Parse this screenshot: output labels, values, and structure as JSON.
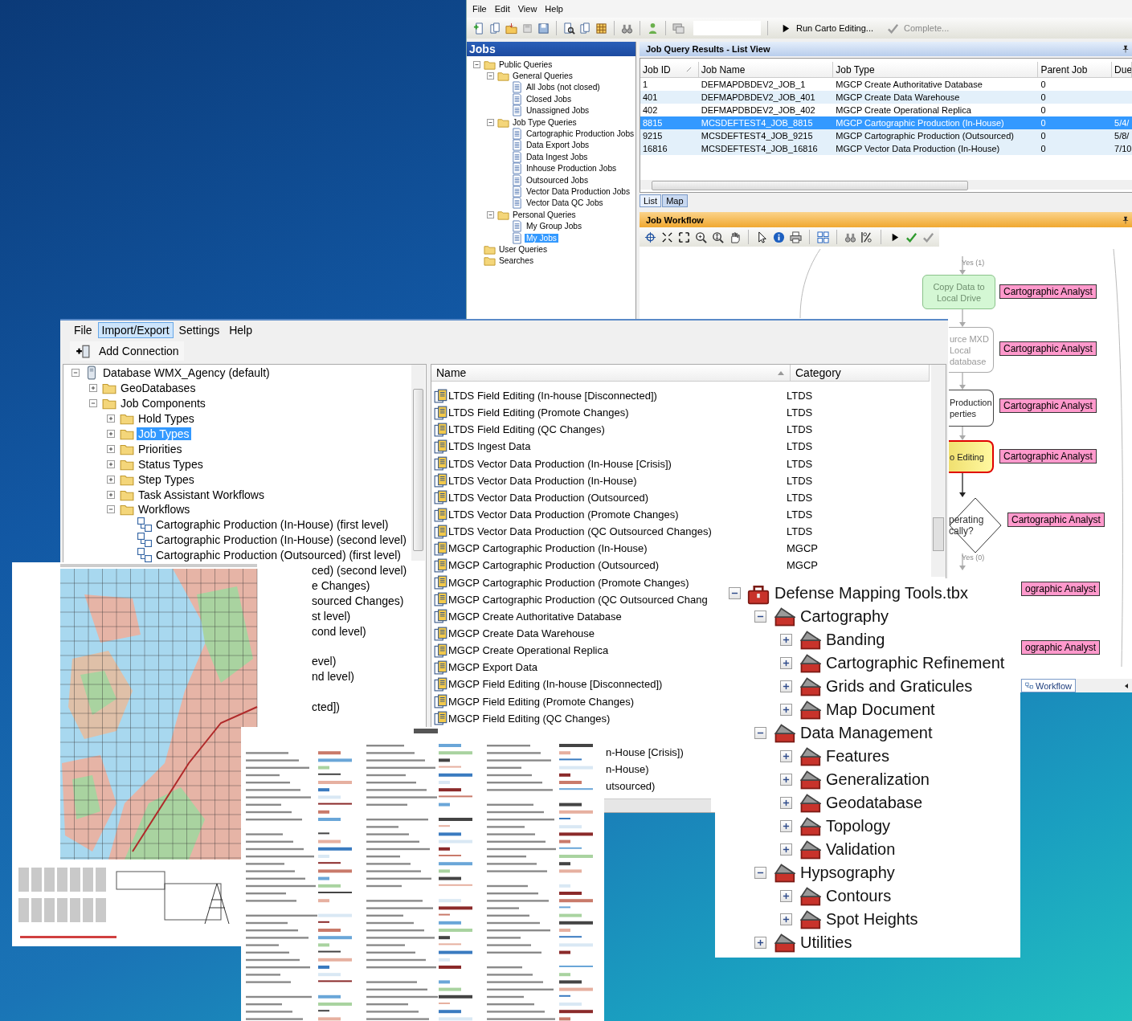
{
  "job_manager": {
    "menu": [
      "File",
      "Edit",
      "View",
      "Help"
    ],
    "toolbar": {
      "run_button": "Run Carto Editing...",
      "complete_button": {
        "label": "Complete...",
        "disabled": true
      }
    },
    "jobs_panel": {
      "title": "Jobs",
      "tree": [
        {
          "kind": "folder",
          "label": "Public Queries",
          "expanded": true,
          "selected": false,
          "children": [
            {
              "kind": "folder",
              "label": "General Queries",
              "expanded": true,
              "selected": false,
              "children": [
                {
                  "kind": "query",
                  "label": "All Jobs (not closed)",
                  "selected": false
                },
                {
                  "kind": "query",
                  "label": "Closed Jobs",
                  "selected": false
                },
                {
                  "kind": "query",
                  "label": "Unassigned Jobs",
                  "selected": false
                }
              ]
            },
            {
              "kind": "folder",
              "label": "Job Type Queries",
              "expanded": true,
              "selected": false,
              "children": [
                {
                  "kind": "query",
                  "label": "Cartographic Production Jobs",
                  "selected": false
                },
                {
                  "kind": "query",
                  "label": "Data Export Jobs",
                  "selected": false
                },
                {
                  "kind": "query",
                  "label": "Data Ingest Jobs",
                  "selected": false
                },
                {
                  "kind": "query",
                  "label": "Inhouse Production Jobs",
                  "selected": false
                },
                {
                  "kind": "query",
                  "label": "Outsourced Jobs",
                  "selected": false
                },
                {
                  "kind": "query",
                  "label": "Vector Data Production Jobs",
                  "selected": false
                },
                {
                  "kind": "query",
                  "label": "Vector Data QC Jobs",
                  "selected": false
                }
              ]
            },
            {
              "kind": "folder",
              "label": "Personal Queries",
              "expanded": true,
              "selected": false,
              "children": [
                {
                  "kind": "query",
                  "label": "My Group Jobs",
                  "selected": false
                },
                {
                  "kind": "query",
                  "label": "My Jobs",
                  "selected": true
                }
              ]
            }
          ]
        },
        {
          "kind": "folder",
          "label": "User Queries",
          "selected": false
        },
        {
          "kind": "folder",
          "label": "Searches",
          "selected": false
        }
      ]
    },
    "query_results": {
      "title": "Job Query Results - List View",
      "columns": [
        {
          "label": "Job ID",
          "sorted": true
        },
        {
          "label": "Job Name",
          "sorted": false
        },
        {
          "label": "Job Type",
          "sorted": false
        },
        {
          "label": "Parent Job",
          "sorted": false
        },
        {
          "label": "Due",
          "sorted": false
        }
      ],
      "rows": [
        {
          "cells": [
            "1",
            "DEFMAPDBDEV2_JOB_1",
            "MGCP Create Authoritative Database",
            "0"
          ],
          "selected": false
        },
        {
          "cells": [
            "401",
            "DEFMAPDBDEV2_JOB_401",
            "MGCP Create Data Warehouse",
            "0"
          ],
          "selected": false
        },
        {
          "cells": [
            "402",
            "DEFMAPDBDEV2_JOB_402",
            "MGCP Create Operational Replica",
            "0"
          ],
          "selected": false
        },
        {
          "cells": [
            "8815",
            "MCSDEFTEST4_JOB_8815",
            "MGCP Cartographic Production (In-House)",
            "0",
            "5/4/"
          ],
          "selected": true
        },
        {
          "cells": [
            "9215",
            "MCSDEFTEST4_JOB_9215",
            "MGCP Cartographic Production (Outsourced)",
            "0",
            "5/8/"
          ],
          "selected": false
        },
        {
          "cells": [
            "16816",
            "MCSDEFTEST4_JOB_16816",
            "MGCP Vector Data Production (In-House)",
            "0",
            "7/10"
          ],
          "selected": false
        }
      ],
      "view_tabs": [
        {
          "label": "List",
          "selected": true
        },
        {
          "label": "Map",
          "selected": false
        }
      ]
    },
    "workflow": {
      "title": "Job Workflow",
      "items": [
        {
          "kind": "edge_label",
          "text": "Yes (1)"
        },
        {
          "kind": "step",
          "lines": [
            "Copy Data to",
            "Local Drive"
          ],
          "completed": true,
          "current": false,
          "dimmed": false,
          "role": "Cartographic Analyst"
        },
        {
          "kind": "step",
          "lines": [
            "urce MXD",
            "Local",
            "database"
          ],
          "completed": false,
          "current": false,
          "dimmed": true,
          "role": "Cartographic Analyst"
        },
        {
          "kind": "step",
          "lines": [
            "Production",
            "perties"
          ],
          "completed": false,
          "current": false,
          "dimmed": false,
          "role": "Cartographic Analyst"
        },
        {
          "kind": "step",
          "lines": [
            "o Editing"
          ],
          "completed": false,
          "current": true,
          "dimmed": false,
          "role": "Cartographic Analyst"
        },
        {
          "kind": "decision",
          "lines": [
            "perating",
            "cally?"
          ],
          "role": "Cartographic Analyst"
        },
        {
          "kind": "edge_label",
          "text": "Yes (0)"
        },
        {
          "kind": "role_only",
          "role": "ographic Analyst"
        },
        {
          "kind": "role_only",
          "role": "ographic Analyst"
        }
      ],
      "tabs": [
        {
          "label": "Workflow",
          "selected": true
        }
      ]
    }
  },
  "workflow_manager": {
    "menu": [
      {
        "label": "File",
        "selected": false
      },
      {
        "label": "Import/Export",
        "selected": true
      },
      {
        "label": "Settings",
        "selected": false
      },
      {
        "label": "Help",
        "selected": false
      }
    ],
    "add_connection": "Add Connection",
    "tree": [
      {
        "kind": "database",
        "label": "Database WMX_Agency (default)",
        "expanded": true,
        "selected": false,
        "children": [
          {
            "kind": "folder",
            "label": "GeoDatabases",
            "expanded": false,
            "selected": false
          },
          {
            "kind": "folder",
            "label": "Job Components",
            "expanded": true,
            "selected": false,
            "children": [
              {
                "kind": "folder",
                "label": "Hold Types",
                "expanded": false,
                "selected": false
              },
              {
                "kind": "folder",
                "label": "Job Types",
                "expanded": false,
                "selected": true
              },
              {
                "kind": "folder",
                "label": "Priorities",
                "expanded": false,
                "selected": false
              },
              {
                "kind": "folder",
                "label": "Status Types",
                "expanded": false,
                "selected": false
              },
              {
                "kind": "folder",
                "label": "Step Types",
                "expanded": false,
                "selected": false
              },
              {
                "kind": "folder",
                "label": "Task Assistant Workflows",
                "expanded": false,
                "selected": false
              },
              {
                "kind": "folder",
                "label": "Workflows",
                "expanded": true,
                "selected": false,
                "children": [
                  {
                    "kind": "workflow",
                    "label": "Cartographic Production (In-House) (first level)",
                    "selected": false
                  },
                  {
                    "kind": "workflow",
                    "label": "Cartographic Production (In-House) (second level)",
                    "selected": false
                  },
                  {
                    "kind": "workflow",
                    "label": "Cartographic Production (Outsourced) (first level)",
                    "selected": false
                  },
                  {
                    "kind": "clipped",
                    "label": "ced) (second level)",
                    "selected": false
                  },
                  {
                    "kind": "clipped",
                    "label": "e Changes)",
                    "selected": false
                  },
                  {
                    "kind": "clipped",
                    "label": "sourced Changes)",
                    "selected": false
                  },
                  {
                    "kind": "clipped",
                    "label": "st level)",
                    "selected": false
                  },
                  {
                    "kind": "clipped",
                    "label": "cond level)",
                    "selected": false
                  },
                  {
                    "kind": "covered"
                  },
                  {
                    "kind": "clipped",
                    "label": "evel)",
                    "selected": false
                  },
                  {
                    "kind": "clipped",
                    "label": "nd level)",
                    "selected": false
                  },
                  {
                    "kind": "covered"
                  },
                  {
                    "kind": "clipped",
                    "label": "cted])",
                    "selected": false
                  }
                ]
              }
            ]
          }
        ]
      }
    ],
    "list": {
      "columns": [
        {
          "label": "Name",
          "sorted": true
        },
        {
          "label": "Category",
          "sorted": false
        }
      ],
      "rows": [
        {
          "kind": "job_type",
          "name": "LTDS Field Editing (In-house [Disconnected])",
          "category": "LTDS"
        },
        {
          "kind": "job_type",
          "name": "LTDS Field Editing (Promote Changes)",
          "category": "LTDS"
        },
        {
          "kind": "job_type",
          "name": "LTDS Field Editing (QC Changes)",
          "category": "LTDS"
        },
        {
          "kind": "job_type",
          "name": "LTDS Ingest Data",
          "category": "LTDS"
        },
        {
          "kind": "job_type",
          "name": "LTDS Vector Data Production (In-House [Crisis])",
          "category": "LTDS"
        },
        {
          "kind": "job_type",
          "name": "LTDS Vector Data Production (In-House)",
          "category": "LTDS"
        },
        {
          "kind": "job_type",
          "name": "LTDS Vector Data Production (Outsourced)",
          "category": "LTDS"
        },
        {
          "kind": "job_type",
          "name": "LTDS Vector Data Production (Promote Changes)",
          "category": "LTDS"
        },
        {
          "kind": "job_type",
          "name": "LTDS Vector Data Production (QC Outsourced Changes)",
          "category": "LTDS"
        },
        {
          "kind": "job_type",
          "name": "MGCP Cartographic Production (In-House)",
          "category": "MGCP"
        },
        {
          "kind": "job_type",
          "name": "MGCP Cartographic Production (Outsourced)",
          "category": "MGCP"
        },
        {
          "kind": "job_type",
          "name": "MGCP Cartographic Production (Promote Changes)"
        },
        {
          "kind": "job_type",
          "name": "MGCP Cartographic Production (QC Outsourced Chang"
        },
        {
          "kind": "job_type",
          "name": "MGCP Create Authoritative Database"
        },
        {
          "kind": "job_type",
          "name": "MGCP Create Data Warehouse"
        },
        {
          "kind": "job_type",
          "name": "MGCP Create Operational Replica"
        },
        {
          "kind": "job_type",
          "name": "MGCP Export Data"
        },
        {
          "kind": "job_type",
          "name": "MGCP Field Editing (In-house [Disconnected])"
        },
        {
          "kind": "job_type",
          "name": "MGCP Field Editing (Promote Changes)"
        },
        {
          "kind": "job_type",
          "name": "MGCP Field Editing (QC Changes)"
        },
        {
          "kind": "covered"
        },
        {
          "kind": "clipped",
          "name": "n-House [Crisis])"
        },
        {
          "kind": "clipped",
          "name": "n-House)"
        },
        {
          "kind": "clipped",
          "name": "utsourced)"
        }
      ]
    }
  },
  "toolbox": {
    "tree": [
      {
        "kind": "toolbox",
        "label": "Defense Mapping Tools.tbx",
        "expanded": true,
        "selected": false,
        "children": [
          {
            "kind": "toolset",
            "label": "Cartography",
            "expanded": true,
            "selected": false,
            "children": [
              {
                "kind": "toolset",
                "label": "Banding",
                "expanded": false,
                "selected": false
              },
              {
                "kind": "toolset",
                "label": "Cartographic Refinement",
                "expanded": false,
                "selected": false
              },
              {
                "kind": "toolset",
                "label": "Grids and Graticules",
                "expanded": false,
                "selected": false
              },
              {
                "kind": "toolset",
                "label": "Map Document",
                "expanded": false,
                "selected": false
              }
            ]
          },
          {
            "kind": "toolset",
            "label": "Data Management",
            "expanded": true,
            "selected": false,
            "children": [
              {
                "kind": "toolset",
                "label": "Features",
                "expanded": false,
                "selected": false
              },
              {
                "kind": "toolset",
                "label": "Generalization",
                "expanded": false,
                "selected": false
              },
              {
                "kind": "toolset",
                "label": "Geodatabase",
                "expanded": false,
                "selected": false
              },
              {
                "kind": "toolset",
                "label": "Topology",
                "expanded": false,
                "selected": false
              },
              {
                "kind": "toolset",
                "label": "Validation",
                "expanded": false,
                "selected": false
              }
            ]
          },
          {
            "kind": "toolset",
            "label": "Hypsography",
            "expanded": true,
            "selected": false,
            "children": [
              {
                "kind": "toolset",
                "label": "Contours",
                "expanded": false,
                "selected": false
              },
              {
                "kind": "toolset",
                "label": "Spot Heights",
                "expanded": false,
                "selected": false
              }
            ]
          },
          {
            "kind": "toolset",
            "label": "Utilities",
            "expanded": false,
            "selected": false
          }
        ]
      }
    ]
  }
}
